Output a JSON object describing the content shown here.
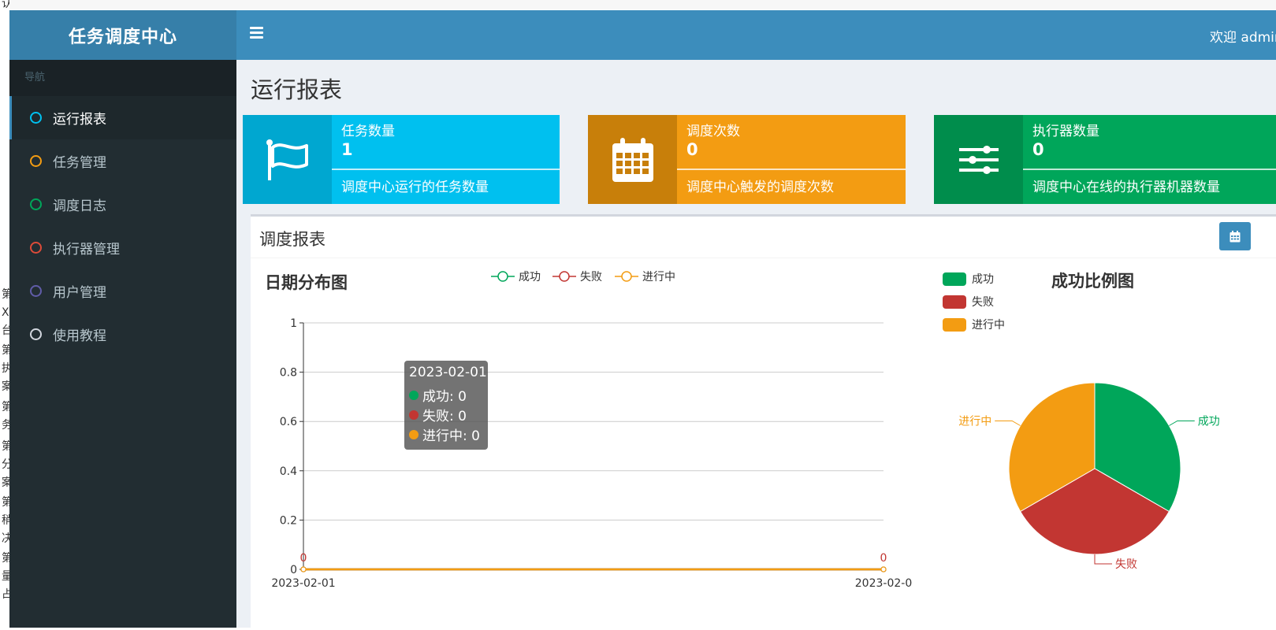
{
  "app": {
    "logo": "任务调度中心",
    "welcome": "欢迎 admin"
  },
  "sidebar": {
    "header": "导航",
    "items": [
      {
        "label": "运行报表",
        "color": "#00c0ef",
        "active": true
      },
      {
        "label": "任务管理",
        "color": "#f39c12",
        "active": false
      },
      {
        "label": "调度日志",
        "color": "#00a65a",
        "active": false
      },
      {
        "label": "执行器管理",
        "color": "#dd4b39",
        "active": false
      },
      {
        "label": "用户管理",
        "color": "#605ca8",
        "active": false
      },
      {
        "label": "使用教程",
        "color": "#d2d6de",
        "active": false
      }
    ]
  },
  "page": {
    "title": "运行报表"
  },
  "infoboxes": [
    {
      "text": "任务数量",
      "number": "1",
      "desc": "调度中心运行的任务数量",
      "icon": "flag-icon",
      "color": "#00c0ef",
      "icon_bg": "#00a7d0"
    },
    {
      "text": "调度次数",
      "number": "0",
      "desc": "调度中心触发的调度次数",
      "icon": "calendar-icon",
      "color": "#f39c12",
      "icon_bg": "#c87f0a"
    },
    {
      "text": "执行器数量",
      "number": "0",
      "desc": "调度中心在线的执行器机器数量",
      "icon": "sliders-icon",
      "color": "#00a65a",
      "icon_bg": "#008d4c"
    }
  ],
  "report": {
    "title": "调度报表",
    "date_button_icon": "calendar-icon"
  },
  "chart_data": [
    {
      "type": "line",
      "title": "日期分布图",
      "x": [
        "2023-02-01",
        "2023-02-0"
      ],
      "series": [
        {
          "name": "成功",
          "color": "#00a65a",
          "values": [
            0,
            0
          ]
        },
        {
          "name": "失败",
          "color": "#c23632",
          "values": [
            0,
            0
          ]
        },
        {
          "name": "进行中",
          "color": "#f39c12",
          "values": [
            0,
            0
          ]
        }
      ],
      "yticks": [
        "0",
        "0.2",
        "0.4",
        "0.6",
        "0.8",
        "1"
      ],
      "ylim": [
        0,
        1
      ],
      "data_labels": [
        "0",
        "0"
      ],
      "legend_position": "top",
      "grid": true,
      "tooltip": {
        "date": "2023-02-01",
        "lines": [
          "成功: 0",
          "失败: 0",
          "进行中: 0"
        ],
        "colors": [
          "#00a65a",
          "#c23632",
          "#f39c12"
        ]
      }
    },
    {
      "type": "pie",
      "title": "成功比例图",
      "slices": [
        {
          "name": "成功",
          "value": 1,
          "color": "#00a65a"
        },
        {
          "name": "失败",
          "value": 1,
          "color": "#c23632"
        },
        {
          "name": "进行中",
          "value": 1,
          "color": "#f39c12"
        }
      ],
      "legend_position": "top-left"
    }
  ]
}
